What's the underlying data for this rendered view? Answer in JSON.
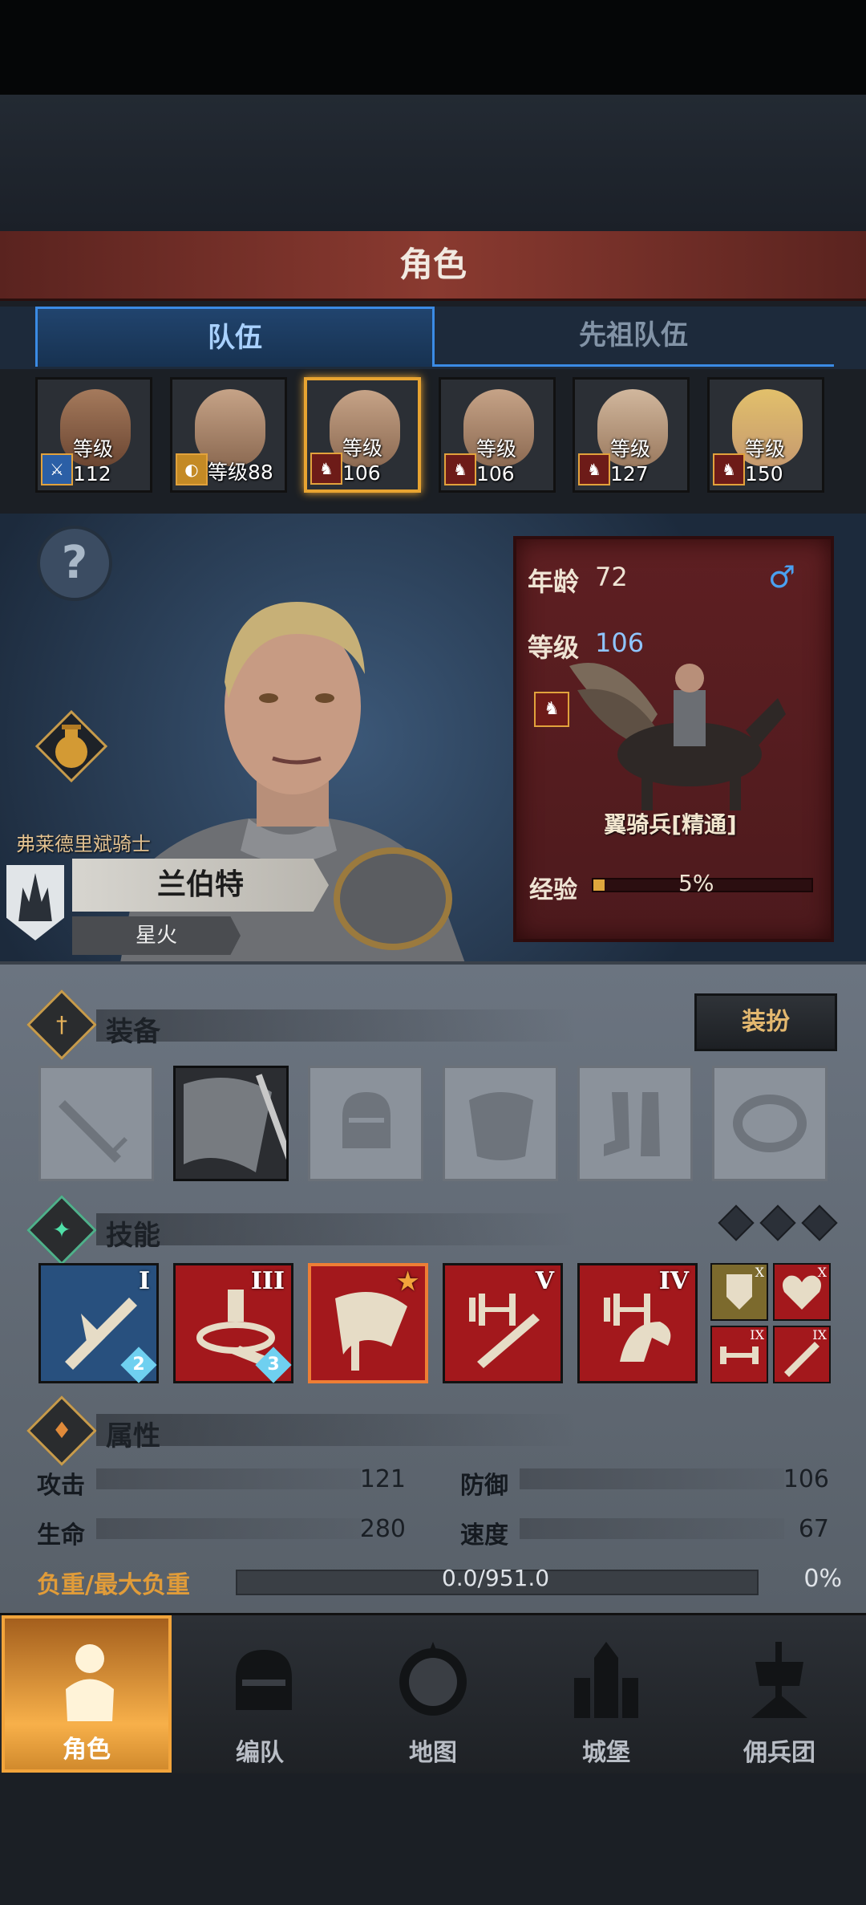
{
  "header": {
    "title": "角色"
  },
  "tabs": [
    {
      "label": "队伍"
    },
    {
      "label": "先祖队伍"
    }
  ],
  "roster": [
    {
      "level": "等级112",
      "badge": "blue"
    },
    {
      "level": "等级88",
      "badge": "gold"
    },
    {
      "level": "等级106",
      "badge": "red",
      "selected": true
    },
    {
      "level": "等级106",
      "badge": "red"
    },
    {
      "level": "等级127",
      "badge": "red"
    },
    {
      "level": "等级150",
      "badge": "red"
    }
  ],
  "hero": {
    "class_title": "弗莱德里斌骑士",
    "name": "兰伯特",
    "title": "星火"
  },
  "info": {
    "age_label": "年龄",
    "age": "72",
    "gender": "♂",
    "level_label": "等级",
    "level": "106",
    "unit_name": "翼骑兵[精通]",
    "exp_label": "经验",
    "exp_value": "5%",
    "exp_fraction": 0.05
  },
  "equipment": {
    "label": "装备",
    "outfit_button": "装扮",
    "slots": [
      "sword-icon",
      "banner-icon",
      "helmet-icon",
      "armor-icon",
      "boots-icon",
      "ring-icon"
    ]
  },
  "skills": {
    "label": "技能",
    "items": [
      {
        "numeral": "I",
        "level": "2",
        "color": "blue"
      },
      {
        "numeral": "III",
        "level": "3",
        "color": "red"
      },
      {
        "numeral": "★",
        "level": "",
        "color": "red"
      },
      {
        "numeral": "V",
        "level": "",
        "color": "red"
      },
      {
        "numeral": "IV",
        "level": "",
        "color": "red"
      }
    ],
    "minis": [
      {
        "numeral": "X"
      },
      {
        "numeral": "X"
      },
      {
        "numeral": "IX"
      },
      {
        "numeral": "IX"
      }
    ]
  },
  "attributes": {
    "label": "属性",
    "attack_label": "攻击",
    "attack": "121",
    "defense_label": "防御",
    "defense": "106",
    "life_label": "生命",
    "life": "280",
    "speed_label": "速度",
    "speed": "67",
    "load_label": "负重/最大负重",
    "load": "0.0/951.0",
    "load_pct": "0%"
  },
  "nav": [
    {
      "label": "角色"
    },
    {
      "label": "编队"
    },
    {
      "label": "地图"
    },
    {
      "label": "城堡"
    },
    {
      "label": "佣兵团"
    }
  ],
  "colors": {
    "accent": "#f2a43b",
    "tab_blue": "#3b8be5",
    "skill_red": "#a3181c",
    "panel_red": "#5e1f22"
  }
}
